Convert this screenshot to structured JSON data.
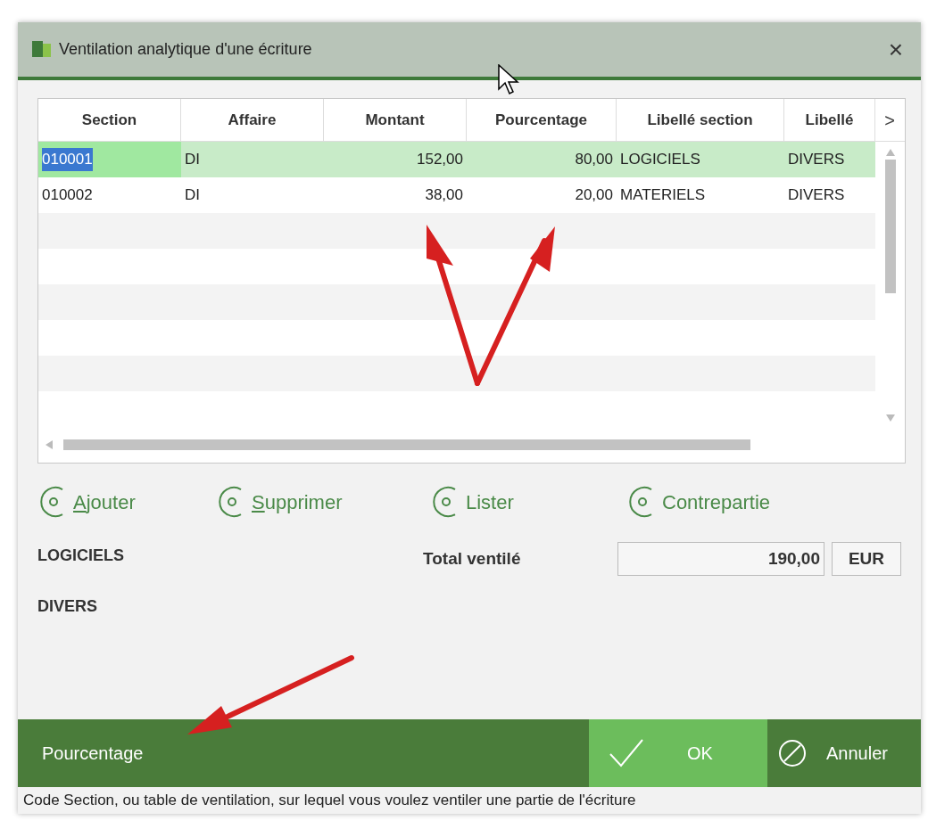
{
  "window": {
    "title": "Ventilation analytique d'une écriture",
    "close": "×"
  },
  "table": {
    "columns": [
      "Section",
      "Affaire",
      "Montant",
      "Pourcentage",
      "Libellé section",
      "Libellé"
    ],
    "more": ">",
    "rows": [
      {
        "cells": [
          "010001",
          "DI",
          "152,00",
          "80,00",
          "LOGICIELS",
          "DIVERS"
        ],
        "selected": true
      },
      {
        "cells": [
          "010002",
          "DI",
          "38,00",
          "20,00",
          "MATERIELS",
          "DIVERS"
        ],
        "selected": false
      }
    ]
  },
  "actions": [
    {
      "label": "Ajouter",
      "underline_first": true
    },
    {
      "label": "Supprimer",
      "underline_first": true
    },
    {
      "label": "Lister",
      "underline_first": false
    },
    {
      "label": "Contrepartie",
      "underline_first": false
    }
  ],
  "info": [
    "LOGICIELS",
    "DIVERS"
  ],
  "total": {
    "label": "Total ventilé",
    "value": "190,00",
    "currency": "EUR"
  },
  "footer": {
    "field": "Pourcentage",
    "ok": "OK",
    "cancel": "Annuler"
  },
  "status_bar": "Code Section, ou table de ventilation, sur lequel vous voulez ventiler une partie de l'écriture"
}
